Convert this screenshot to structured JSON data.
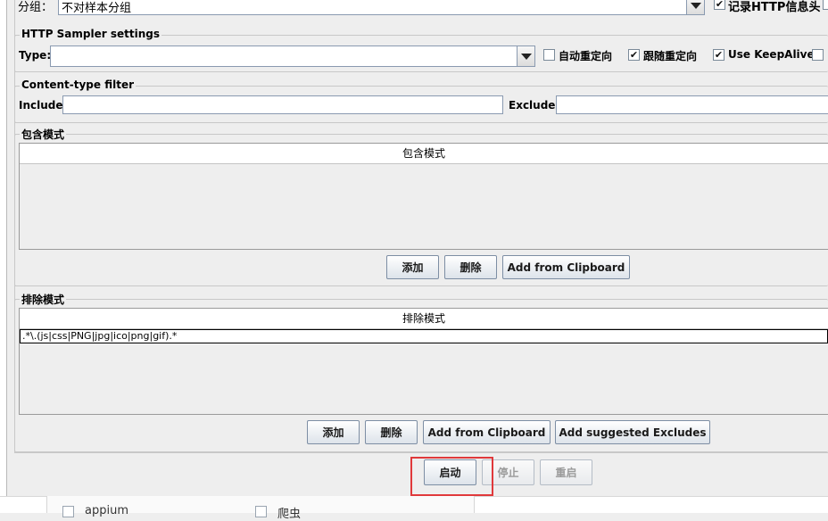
{
  "grouping": {
    "label": "分组：",
    "value": "不对样本分组",
    "record_http_headers_label": "记录HTTP信息头",
    "record_http_headers_checked": true
  },
  "http_sampler": {
    "title": "HTTP Sampler settings",
    "type_label": "Type:",
    "type_value": "",
    "auto_redirect_label": "自动重定向",
    "auto_redirect_checked": false,
    "follow_redirect_label": "跟随重定向",
    "follow_redirect_checked": true,
    "keepalive_label": "Use KeepAlive",
    "keepalive_checked": true
  },
  "content_filter": {
    "title": "Content-type filter",
    "include_label": "Include:",
    "include_value": "",
    "exclude_label": "Exclude:",
    "exclude_value": ""
  },
  "include_patterns": {
    "title": "包含模式",
    "column_header": "包含模式",
    "rows": [],
    "buttons": {
      "add": "添加",
      "delete": "删除",
      "clipboard": "Add from Clipboard"
    }
  },
  "exclude_patterns": {
    "title": "排除模式",
    "column_header": "排除模式",
    "rows": [
      ".*\\.(js|css|PNG|jpg|ico|png|gif).*"
    ],
    "buttons": {
      "add": "添加",
      "delete": "删除",
      "clipboard": "Add from Clipboard",
      "suggested": "Add suggested Excludes"
    }
  },
  "controls": {
    "start": "启动",
    "stop": "停止",
    "restart": "重启"
  },
  "highlight_color": "#e0393b",
  "bottom_list": {
    "item1": "appium",
    "item2": "爬虫"
  }
}
